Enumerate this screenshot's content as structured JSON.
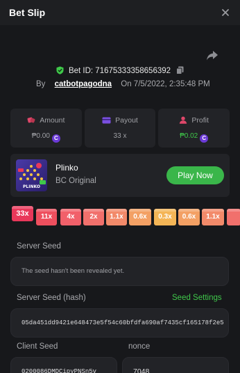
{
  "header": {
    "title": "Bet Slip"
  },
  "bet": {
    "id_text": "Bet ID: 71675333358656392",
    "by_label": "By",
    "user": "catbotpagodna",
    "on_label": "On",
    "date": "7/5/2022, 2:35:48 PM"
  },
  "stats": {
    "amount": {
      "label": "Amount",
      "value": "₱0.00"
    },
    "payout": {
      "label": "Payout",
      "value": "33 x"
    },
    "profit": {
      "label": "Profit",
      "value": "₱0.02"
    },
    "coin_glyph": "C"
  },
  "game": {
    "name": "Plinko",
    "provider": "BC Original",
    "play_label": "Play Now",
    "thumb_text": "PLINKO"
  },
  "multipliers": [
    {
      "label": "33x",
      "color": "#e9385a",
      "highlighted": true
    },
    {
      "label": "11x",
      "color": "#ee4f5e"
    },
    {
      "label": "4x",
      "color": "#f1606a"
    },
    {
      "label": "2x",
      "color": "#f1706c"
    },
    {
      "label": "1.1x",
      "color": "#f28a6a"
    },
    {
      "label": "0.6x",
      "color": "#f3a064"
    },
    {
      "label": "0.3x",
      "color": "#f4b556"
    },
    {
      "label": "0.6x",
      "color": "#f3a064"
    },
    {
      "label": "1.1x",
      "color": "#f28a6a"
    },
    {
      "label": "",
      "color": "#f1706c"
    }
  ],
  "fairness": {
    "server_seed_label": "Server Seed",
    "server_seed_value": "The seed hasn't been revealed yet.",
    "server_hash_label": "Server Seed (hash)",
    "seed_settings_label": "Seed Settings",
    "server_hash_value": "05da451dd9421e648473e5f54c60bfdfa690af7435cf165178f2e5",
    "client_seed_label": "Client Seed",
    "client_seed_value": "0200086DMDCipyPNSn5v",
    "nonce_label": "nonce",
    "nonce_value": "7048"
  },
  "colors": {
    "accent_green": "#3ab64a",
    "coin": "#6b3ad6",
    "background": "#17181b",
    "card": "#222327"
  }
}
